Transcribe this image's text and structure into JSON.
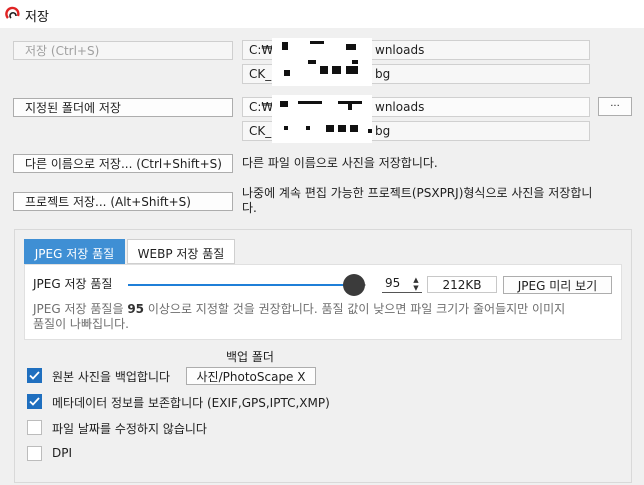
{
  "window": {
    "title": "저장"
  },
  "actions": {
    "save": {
      "label": "저장  (Ctrl+S)",
      "path1": "C:₩",
      "path1_end": "wnloads",
      "path2": "CK_",
      "path2_end": "bg"
    },
    "save_to_folder": {
      "label": "지정된 폴더에 저장",
      "path1": "C:₩",
      "path1_end": "wnloads",
      "path2": "CK_",
      "path2_end": "bg",
      "browse_label": "···"
    },
    "save_as": {
      "label": "다른 이름으로 저장...  (Ctrl+Shift+S)",
      "description": "다른 파일 이름으로 사진을 저장합니다."
    },
    "save_project": {
      "label": "프로젝트 저장...  (Alt+Shift+S)",
      "description_line1": "나중에 계속 편집 가능한 프로젝트(PSXPRJ)형식으로 사진을 저장합니",
      "description_line2": "다."
    }
  },
  "quality": {
    "tabs": [
      {
        "label": "JPEG 저장 품질"
      },
      {
        "label": "WEBP 저장 품질"
      }
    ],
    "slider_label": "JPEG 저장 품질",
    "value": "95",
    "slider_fraction": 0.95,
    "file_size": "212KB",
    "preview_label": "JPEG 미리 보기",
    "note_prefix": "JPEG 저장 품질을 ",
    "note_value": "95",
    "note_suffix": " 이상으로 지정할 것을 권장합니다. 품질 값이 낮으면 파일 크기가 줄어들지만 이미지",
    "note_line2": "품질이 나빠집니다."
  },
  "options": {
    "backup_folder_label": "백업 폴더",
    "backup_folder_value": "사진/PhotoScape X",
    "items": [
      {
        "label": "원본 사진을 백업합니다",
        "checked": true
      },
      {
        "label": "메타데이터 정보를 보존합니다 (EXIF,GPS,IPTC,XMP)",
        "checked": true
      },
      {
        "label": "파일 날짜를 수정하지 않습니다",
        "checked": false
      },
      {
        "label": "DPI",
        "checked": false
      }
    ]
  },
  "colors": {
    "accent": "#3f8fd4",
    "checkbox": "#1f6fbf",
    "slider_thumb": "#3b3b3b"
  }
}
